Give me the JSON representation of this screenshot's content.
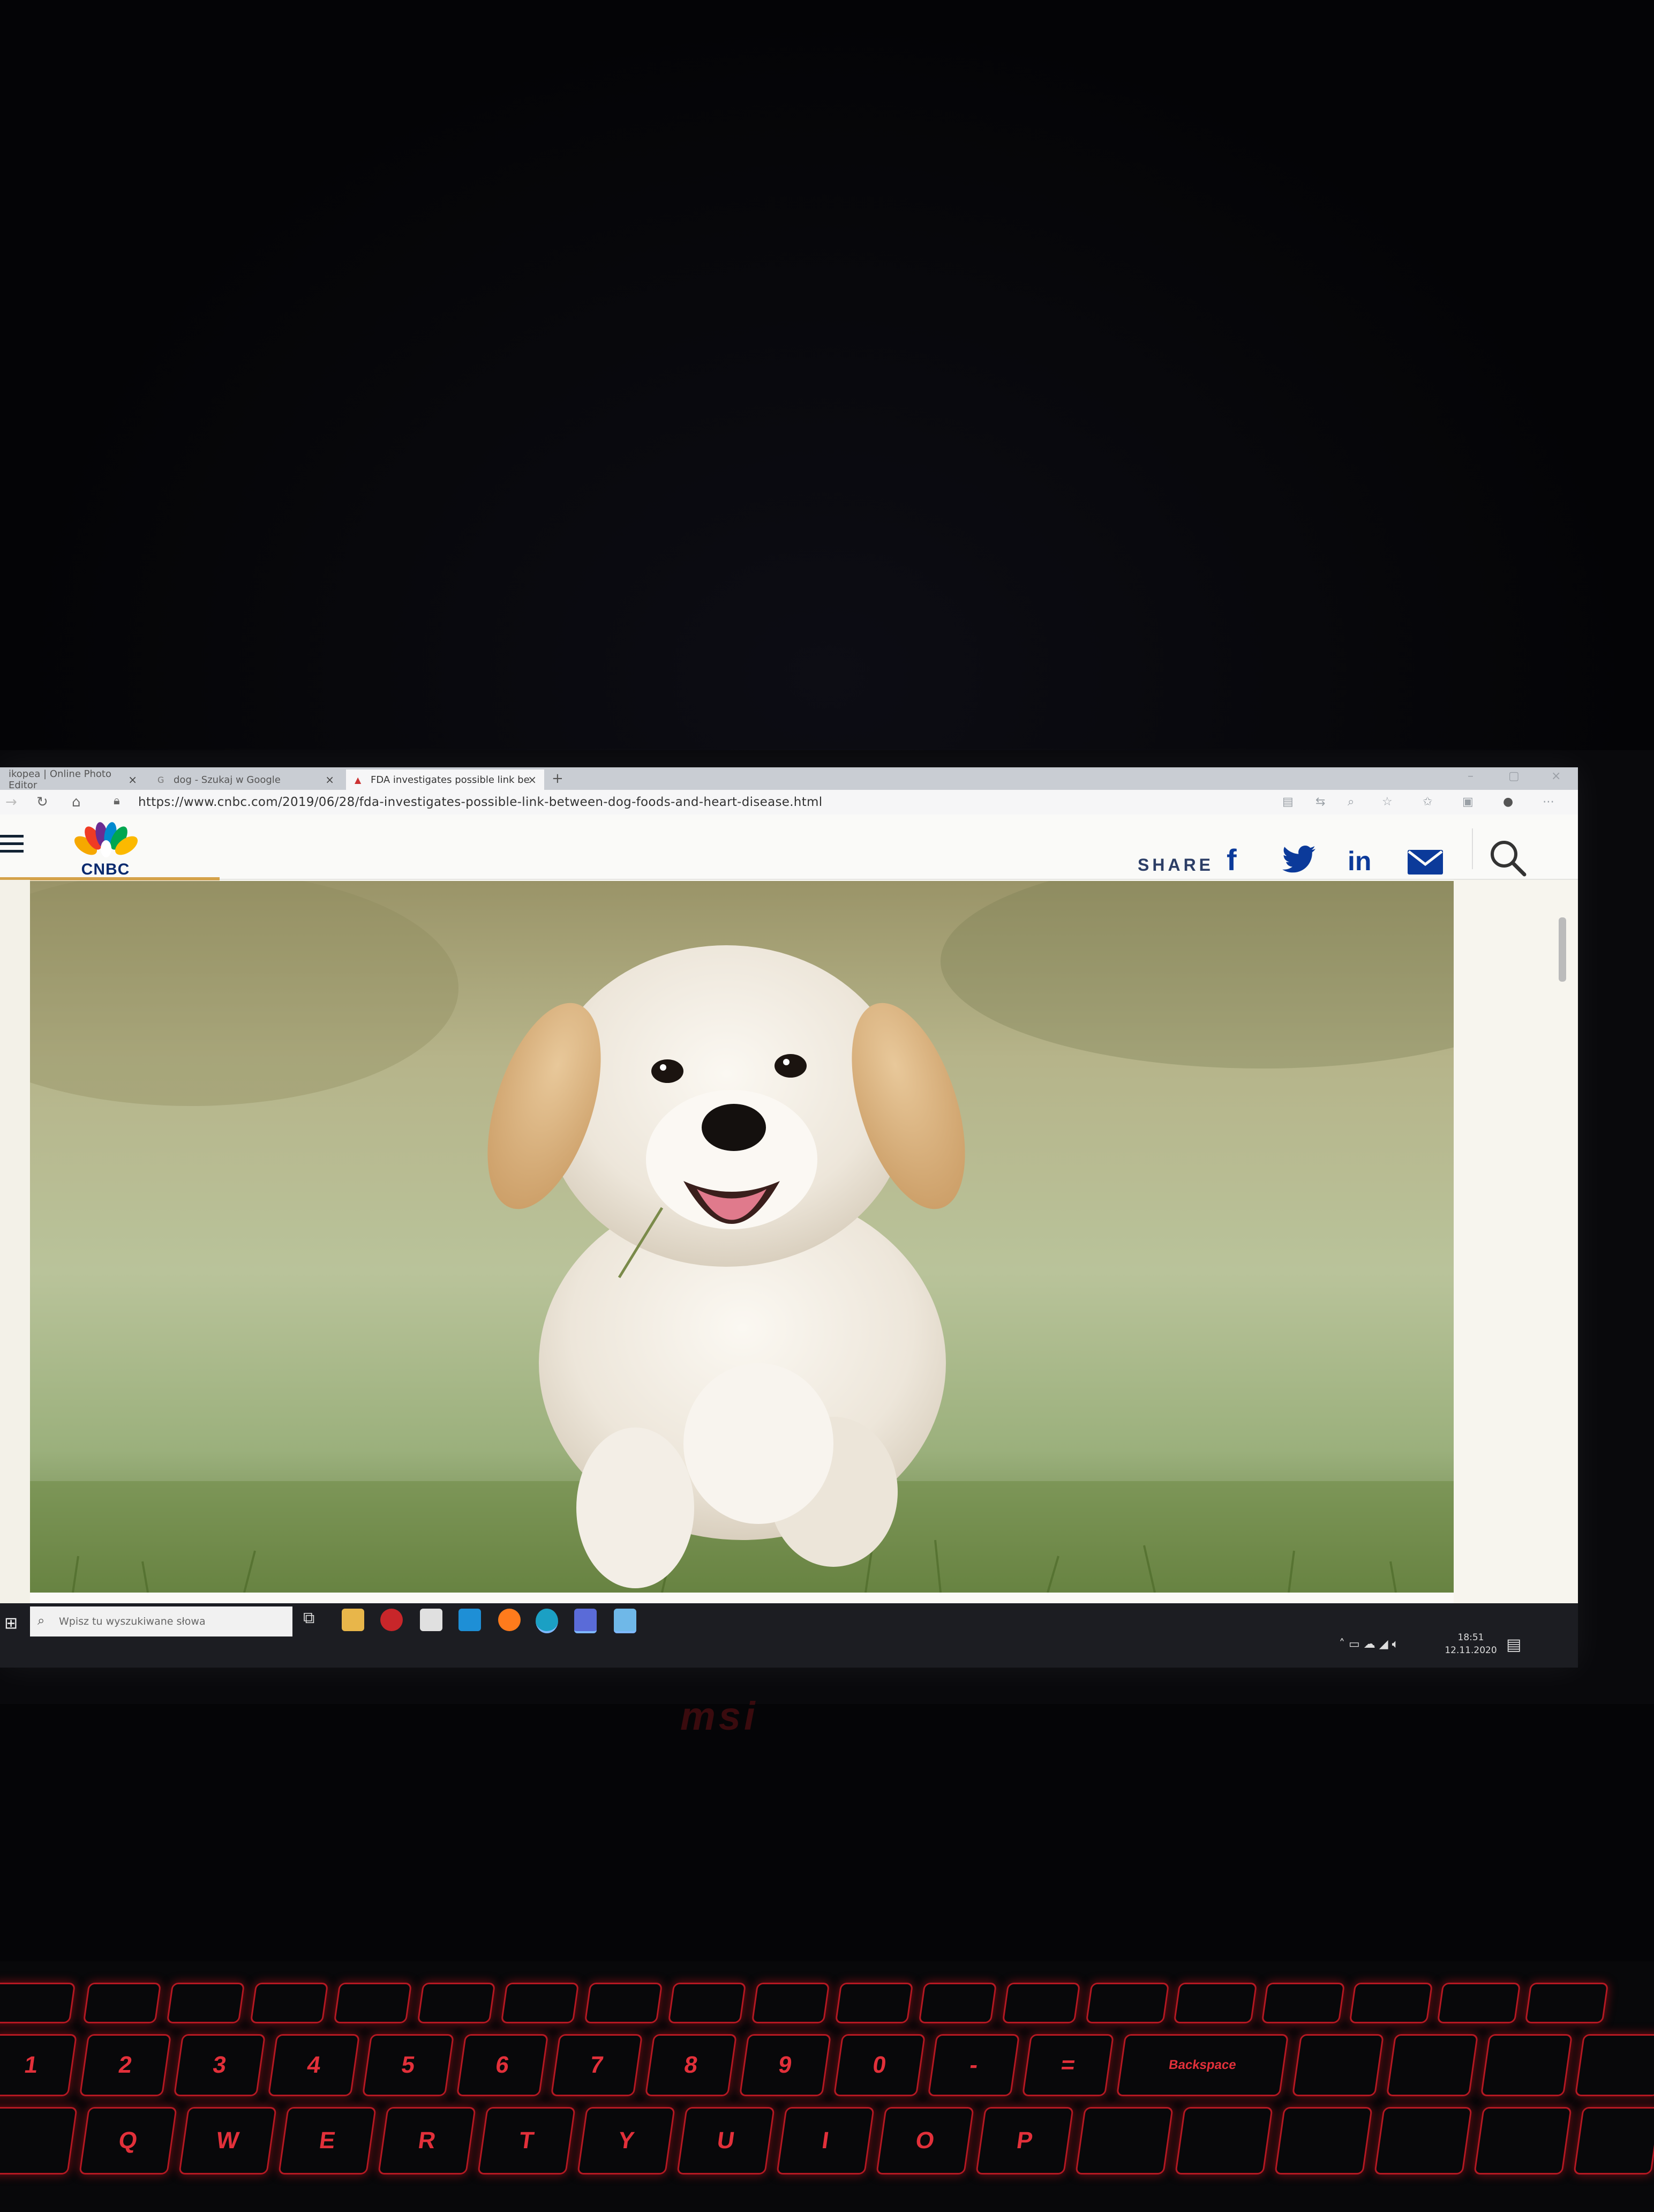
{
  "browser": {
    "tabs": [
      {
        "label": "ikopea | Online Photo Editor",
        "active": false
      },
      {
        "label": "dog - Szukaj w Google",
        "active": false
      },
      {
        "label": "FDA investigates possible link be",
        "active": true
      }
    ],
    "new_tab_label": "+",
    "url": "https://www.cnbc.com/2019/06/28/fda-investigates-possible-link-between-dog-foods-and-heart-disease.html"
  },
  "site": {
    "logo_text": "CNBC",
    "share_label": "SHARE",
    "social": {
      "facebook": "f",
      "linkedin": "in"
    }
  },
  "taskbar": {
    "search_placeholder": "Wpisz tu wyszukiwane słowa",
    "clock_time": "18:51",
    "clock_date": "12.11.2020"
  },
  "laptop": {
    "brand": "msi"
  },
  "keyboard": {
    "row1": [
      "1",
      "2",
      "3",
      "4",
      "5",
      "6",
      "7",
      "8",
      "9",
      "0",
      "-",
      "=",
      "Backspace"
    ],
    "row2": [
      "Q",
      "W",
      "E",
      "R",
      "T",
      "Y",
      "U",
      "I",
      "O",
      "P"
    ]
  },
  "colors": {
    "cnbc_navy": "#0a2a6e",
    "social_blue": "#0b3a9a",
    "keyboard_backlight": "#e2303a",
    "progress_gold": "#d4a24a"
  },
  "icons": [
    "refresh-icon",
    "home-icon",
    "lock-icon",
    "facebook-icon",
    "twitter-icon",
    "linkedin-icon",
    "mail-icon",
    "search-icon",
    "windows-start-icon"
  ]
}
